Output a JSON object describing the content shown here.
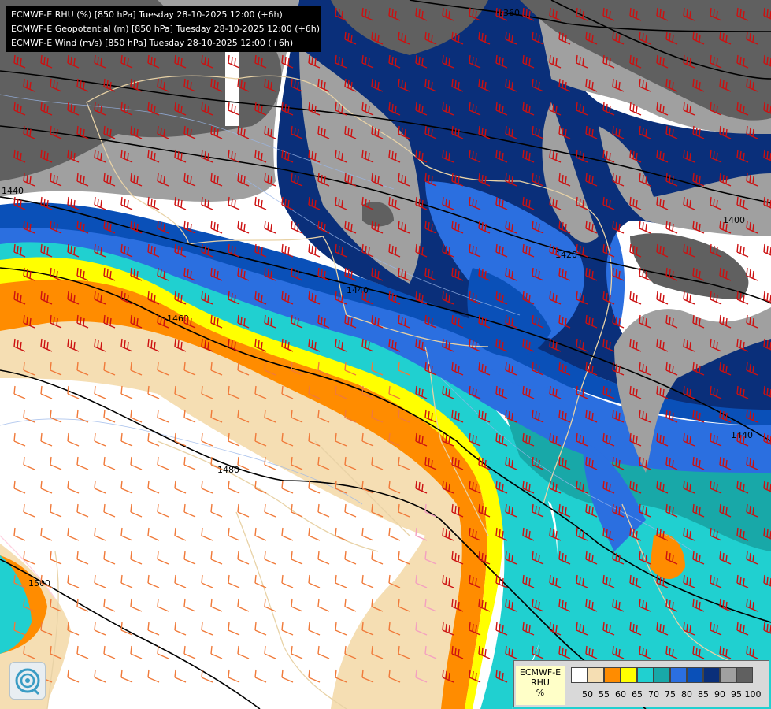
{
  "header": {
    "line1": "ECMWF-E RHU (%) [850 hPa] Tuesday 28-10-2025 12:00 (+6h)",
    "line2": "ECMWF-E Geopotential (m) [850 hPa] Tuesday 28-10-2025 12:00 (+6h)",
    "line3": "ECMWF-E Wind (m/s) [850 hPa] Tuesday 28-10-2025 12:00 (+6h)"
  },
  "legend": {
    "title_line1": "ECMWF-E",
    "title_line2": "RHU",
    "title_line3": "%",
    "colors": [
      "#ffffff",
      "#f5deb3",
      "#ff8c00",
      "#ffff00",
      "#20d0d0",
      "#18a8a8",
      "#2b6fe0",
      "#0a50b8",
      "#0a2f7a",
      "#a0a0a0",
      "#606060"
    ],
    "ticks": [
      "50",
      "55",
      "60",
      "65",
      "70",
      "75",
      "80",
      "85",
      "90",
      "95",
      "100"
    ]
  },
  "contours": {
    "labels": [
      "1360",
      "1400",
      "1420",
      "1440",
      "1440",
      "1440",
      "1460",
      "1480",
      "1500"
    ]
  },
  "logo": {
    "icon": "ecmwf-swirl-logo"
  }
}
